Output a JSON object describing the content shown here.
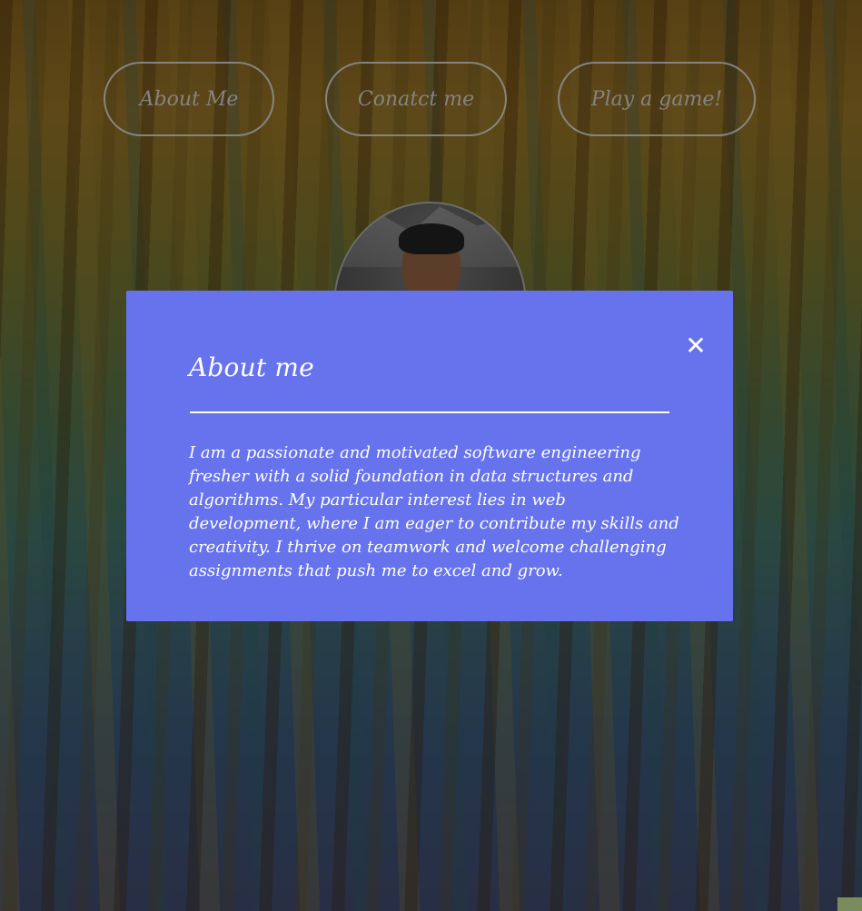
{
  "nav": {
    "about_label": "About Me",
    "contact_label": "Conatct me",
    "game_label": "Play a game!"
  },
  "modal": {
    "title": "About me",
    "close_symbol": "✕",
    "body": "I am a passionate and motivated software engineering fresher with a solid foundation in data structures and algorithms. My particular interest lies in web development, where I am eager to contribute my skills and creativity. I thrive on teamwork and welcome challenging assignments that push me to excel and grow.",
    "background_color": "#6673ec"
  },
  "icons": {
    "close": "close-icon",
    "avatar": "profile-photo"
  }
}
